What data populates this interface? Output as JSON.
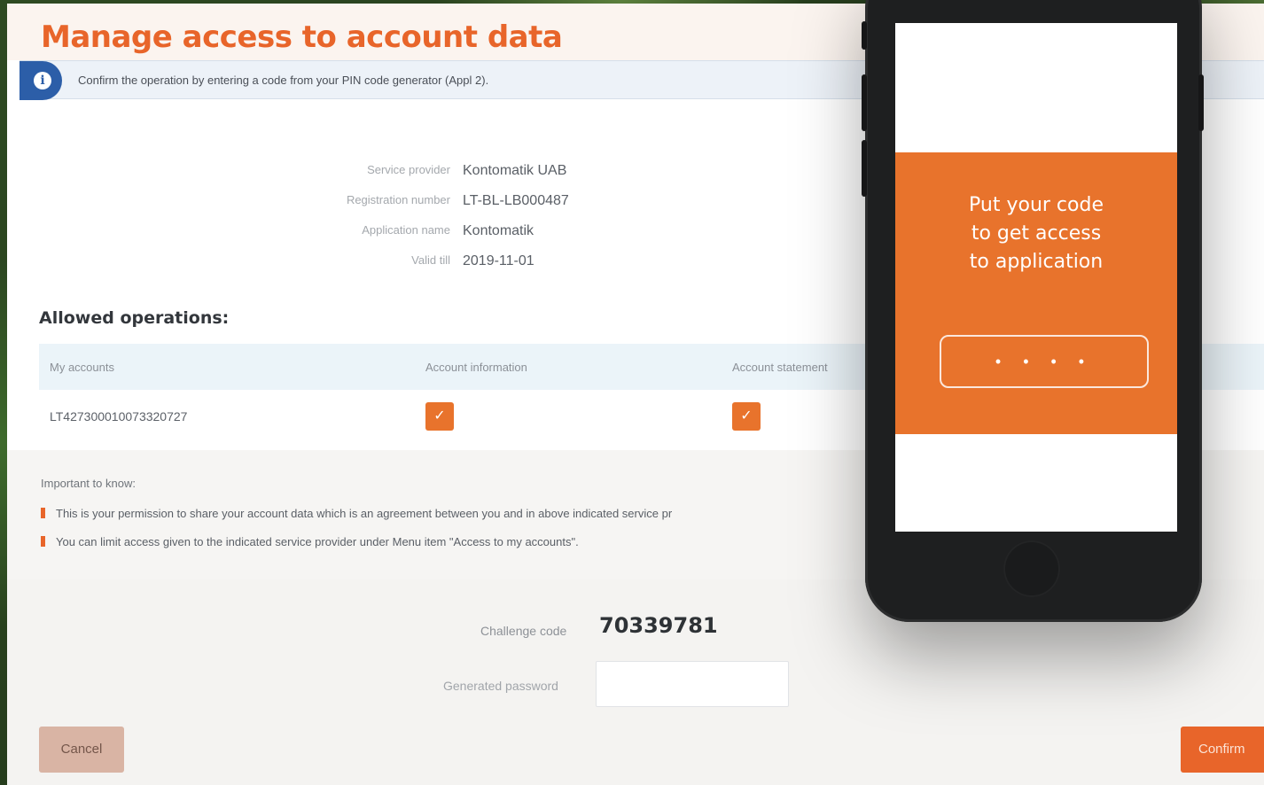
{
  "page": {
    "title": "Manage access to account data",
    "info_message": "Confirm the operation by entering a code from your PIN code generator (Appl 2)."
  },
  "details": [
    {
      "label": "Service provider",
      "value": "Kontomatik UAB"
    },
    {
      "label": "Registration number",
      "value": "LT-BL-LB000487"
    },
    {
      "label": "Application name",
      "value": "Kontomatik"
    },
    {
      "label": "Valid till",
      "value": "2019-11-01"
    }
  ],
  "allowed_operations": {
    "title": "Allowed operations:",
    "columns": [
      "My accounts",
      "Account information",
      "Account statement"
    ],
    "rows": [
      {
        "account": "LT427300010073320727",
        "account_information": true,
        "account_statement": true
      }
    ]
  },
  "important": {
    "title": "Important to know:",
    "items": [
      "This is your permission to share your account data which is an agreement between you and in above indicated service pr",
      "You can limit access given to the indicated service provider under Menu item \"Access to my accounts\"."
    ]
  },
  "challenge": {
    "label": "Challenge code",
    "code": "70339781",
    "password_label": "Generated password",
    "password_value": ""
  },
  "buttons": {
    "cancel": "Cancel",
    "confirm": "Confirm"
  },
  "phone": {
    "prompt_line1": "Put your code",
    "prompt_line2": "to get access",
    "prompt_line3": "to application",
    "code_mask": "• • • •"
  },
  "colors": {
    "accent": "#e8652a",
    "info": "#2c5ea8"
  },
  "icons": {
    "info": "info-icon",
    "checkbox_checked": "check-icon"
  }
}
